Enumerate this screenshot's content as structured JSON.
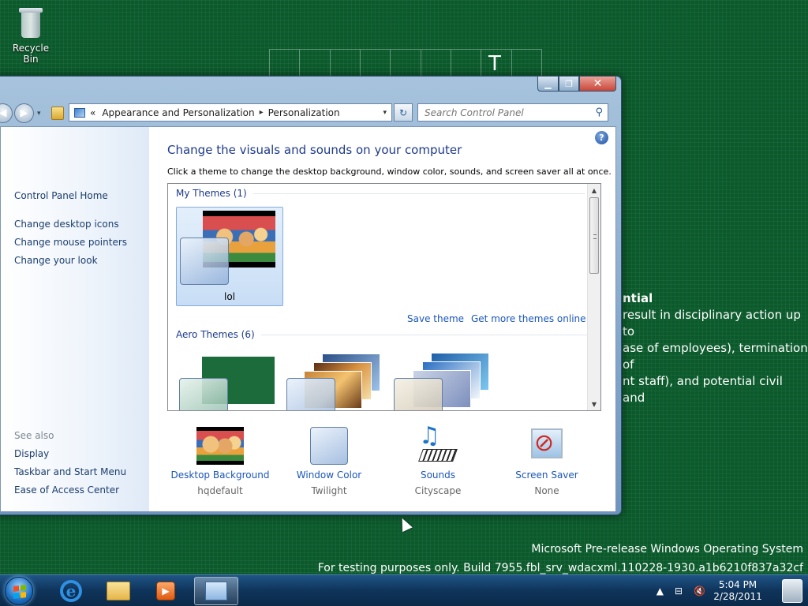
{
  "desktop": {
    "recycle_bin_label": "Recycle Bin",
    "grid_letter": "T",
    "background_text": {
      "title_fragment": "ntial",
      "lines": [
        "result in disciplinary action up to",
        "ase of employees), termination of",
        "nt staff), and potential civil and"
      ]
    },
    "watermark_line1": "Microsoft Pre-release Windows Operating System",
    "watermark_line2": "For testing purposes only. Build 7955.fbl_srv_wdacxml.110228-1930.a1b6210f837a32cf"
  },
  "window": {
    "controls": {
      "minimize": "▁",
      "maximize": "❐",
      "close": "✕"
    },
    "nav": {
      "back": "◀",
      "forward": "▶",
      "history": "▾"
    },
    "address": {
      "lead": "«",
      "crumbs": [
        "Appearance and Personalization",
        "Personalization"
      ],
      "separator": "▸",
      "dropdown": "▾"
    },
    "refresh_glyph": "↻",
    "search": {
      "placeholder": "Search Control Panel",
      "glyph": "⚲"
    },
    "help_glyph": "?"
  },
  "left_pane": {
    "home": "Control Panel Home",
    "tasks": [
      "Change desktop icons",
      "Change mouse pointers",
      "Change your look"
    ],
    "see_also_heading": "See also",
    "see_also": [
      "Display",
      "Taskbar and Start Menu",
      "Ease of Access Center"
    ]
  },
  "main": {
    "title": "Change the visuals and sounds on your computer",
    "subtitle": "Click a theme to change the desktop background, window color, sounds, and screen saver all at once.",
    "my_themes_heading": "My Themes (1)",
    "my_theme_name": "lol",
    "save_theme": "Save theme",
    "get_more": "Get more themes online",
    "aero_heading": "Aero Themes (6)",
    "scroll": {
      "up": "▲",
      "down": "▼"
    },
    "bottom": [
      {
        "label": "Desktop Background",
        "value": "hqdefault"
      },
      {
        "label": "Window Color",
        "value": "Twilight"
      },
      {
        "label": "Sounds",
        "value": "Cityscape"
      },
      {
        "label": "Screen Saver",
        "value": "None"
      }
    ],
    "sounds_icon_glyph": "♫",
    "screensaver_icon_glyph": "⊘"
  },
  "taskbar": {
    "ie_glyph": "e",
    "media_glyph": "▶",
    "tray": {
      "expand": "▲",
      "network": "⊟",
      "volume": "🔇"
    },
    "clock_time": "5:04 PM",
    "clock_date": "2/28/2011"
  }
}
